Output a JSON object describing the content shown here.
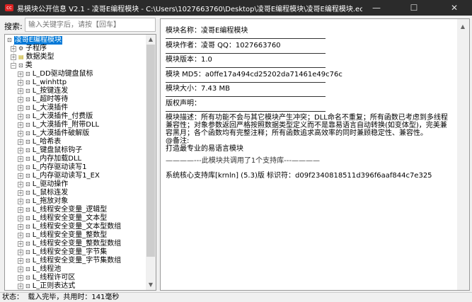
{
  "window": {
    "title": "易模块公开信息 V2.1 - 凌哥E编程模块 - C:\\Users\\1027663760\\Desktop\\凌哥E编程模块\\凌哥E编程模块.ec",
    "minimize": "—",
    "maximize": "☐",
    "close": "✕"
  },
  "search": {
    "label": "搜索:",
    "placeholder": "输入关键字后，请按【回车】"
  },
  "tree": {
    "root": "凌哥E编程模块",
    "top_items": [
      "子程序",
      "数据类型",
      "类"
    ],
    "classes": [
      "L_DD驱动键盘鼠标",
      "L_winhttp",
      "L_按键连发",
      "L_超时等待",
      "L_大漠插件",
      "L_大漠插件_付费版",
      "L_大漠插件_附带DLL",
      "L_大漠插件破解版",
      "L_哈希表",
      "L_键盘鼠标钩子",
      "L_内存加载DLL",
      "L_内存驱动读写1",
      "L_内存驱动读写1_EX",
      "L_驱动操作",
      "L_鼠标连发",
      "L_拖放对象",
      "L_线程安全变量_逻辑型",
      "L_线程安全变量_文本型",
      "L_线程安全变量_文本型数组",
      "L_线程安全变量_整数型",
      "L_线程安全变量_整数型数组",
      "L_线程安全变量_字节集",
      "L_线程安全变量_字节集数组",
      "L_线程池",
      "L_线程许可区",
      "L_正则表达式"
    ]
  },
  "info": {
    "fields": [
      "模块名称：凌哥E编程模块",
      "模块作者：凌哥 QQ：1027663760",
      "模块版本：1.0",
      "模块 MD5：a0ffe17a494cd25202da71461e49c76c",
      "模块大小：7.43 MB",
      "版权声明："
    ],
    "description": "模块描述：所有功能不会与其它模块产生冲突；DLL命名不重复；所有函数已考虑到多线程兼容性；对象参数返回严格按照数据类型定义而不是靠易语言自动转换(如变体型)，完美兼容黑月；各个函数均有完整注释；所有函数追求高效率的同时兼顾稳定性、兼容性。",
    "remark_label": "@备注:",
    "remark": "打造最专业的易语言模块",
    "separator": "————---此模块共调用了1个支持库---————",
    "library": "系统核心支持库[krnln] (5.3)版 标识符：d09f2340818511d396f6aaf844c7e325"
  },
  "status": "状态：  载入完毕，共用时：141毫秒"
}
